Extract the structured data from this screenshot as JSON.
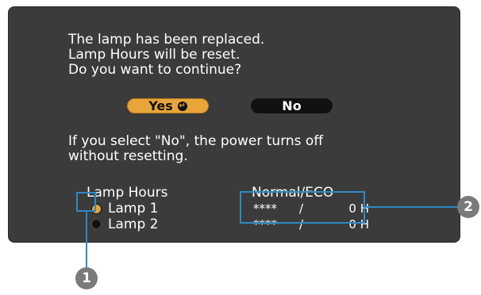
{
  "dialog": {
    "message_lines": [
      "The lamp has been replaced.",
      "Lamp Hours will be reset.",
      "Do you want to continue?"
    ],
    "yes_label": "Yes",
    "no_label": "No",
    "info_lines": [
      "If you select \"No\", the power turns off",
      "without resetting."
    ],
    "lamp_hours_title": "Lamp Hours",
    "mode_title": "Normal/ECO",
    "lamps": [
      {
        "label": "Lamp 1",
        "normal": "****",
        "separator": "/",
        "eco": "0 H",
        "selected": true
      },
      {
        "label": "Lamp 2",
        "normal": "****",
        "separator": "/",
        "eco": "0 H",
        "selected": false
      }
    ]
  },
  "callouts": [
    "1",
    "2"
  ],
  "colors": {
    "screen_bg": "#3b3b3b",
    "accent_yes": "#e8a53c",
    "callout_line": "#2f89c6"
  }
}
